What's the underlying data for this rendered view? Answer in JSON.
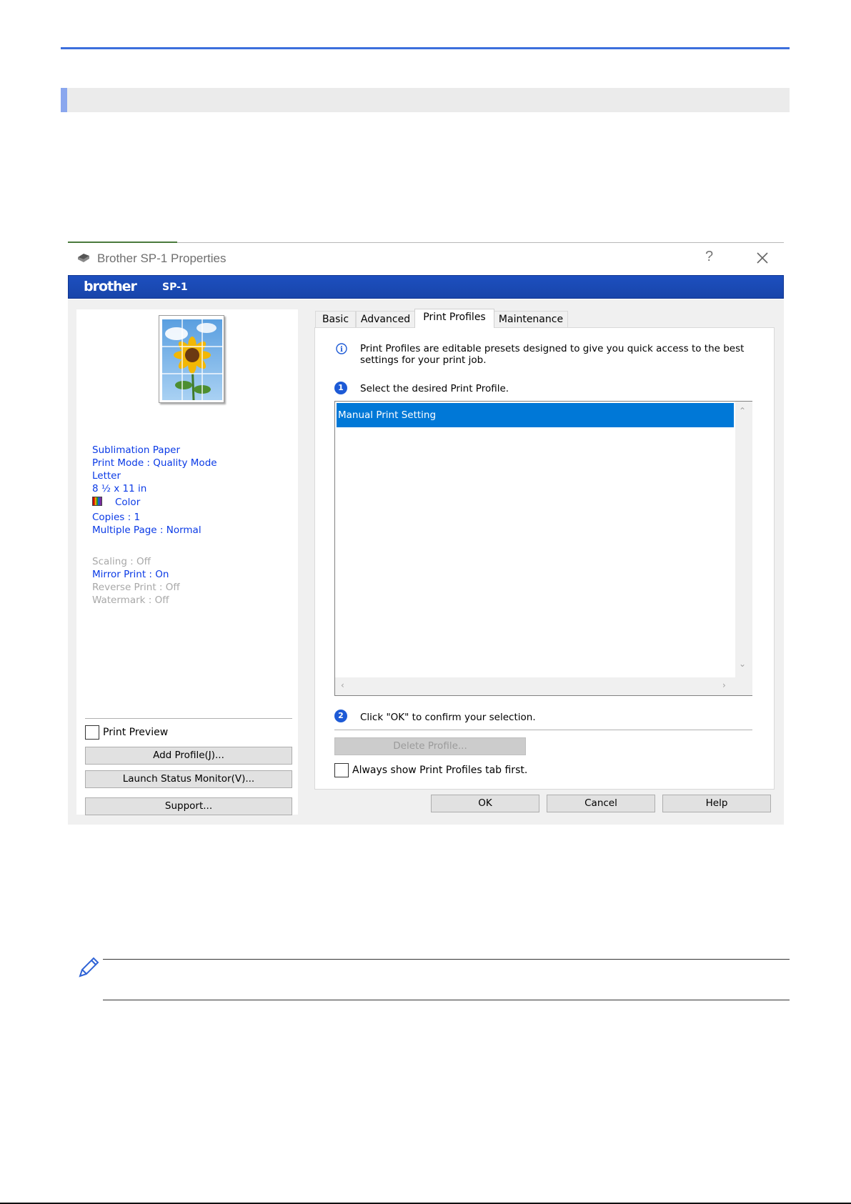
{
  "dialog": {
    "title": "Brother SP-1 Properties",
    "help_glyph": "?",
    "brand": "brother",
    "model": "SP-1"
  },
  "summary": {
    "media": "Sublimation Paper",
    "print_mode": "Print Mode : Quality Mode",
    "paper_size": "Letter",
    "paper_dims": "8 ½ x 11 in",
    "color": "Color",
    "copies": "Copies : 1",
    "multiple_page": "Multiple Page : Normal",
    "scaling": "Scaling : Off",
    "mirror_print": "Mirror Print : On",
    "reverse_print": "Reverse Print : Off",
    "watermark": "Watermark : Off"
  },
  "left_controls": {
    "print_preview": "Print Preview",
    "add_profile": "Add Profile(J)...",
    "launch_status_monitor": "Launch Status Monitor(V)...",
    "support": "Support..."
  },
  "tabs": [
    {
      "label": "Basic",
      "active": false
    },
    {
      "label": "Advanced",
      "active": false
    },
    {
      "label": "Print Profiles",
      "active": true
    },
    {
      "label": "Maintenance",
      "active": false
    }
  ],
  "print_profiles": {
    "info": "Print Profiles are editable presets designed to give you quick access to the best settings for your print job.",
    "step1": "Select the desired Print Profile.",
    "profiles": [
      "Manual Print Setting"
    ],
    "step2": "Click \"OK\" to confirm your selection.",
    "delete_profile": "Delete Profile...",
    "always_show": "Always show Print Profiles tab first."
  },
  "footer_buttons": {
    "ok": "OK",
    "cancel": "Cancel",
    "help": "Help"
  },
  "colors": {
    "accent_rule": "#3c6fdc",
    "banner": "#1d4fbf",
    "selection": "#0078d7",
    "summary_text": "#0a3ae6"
  }
}
